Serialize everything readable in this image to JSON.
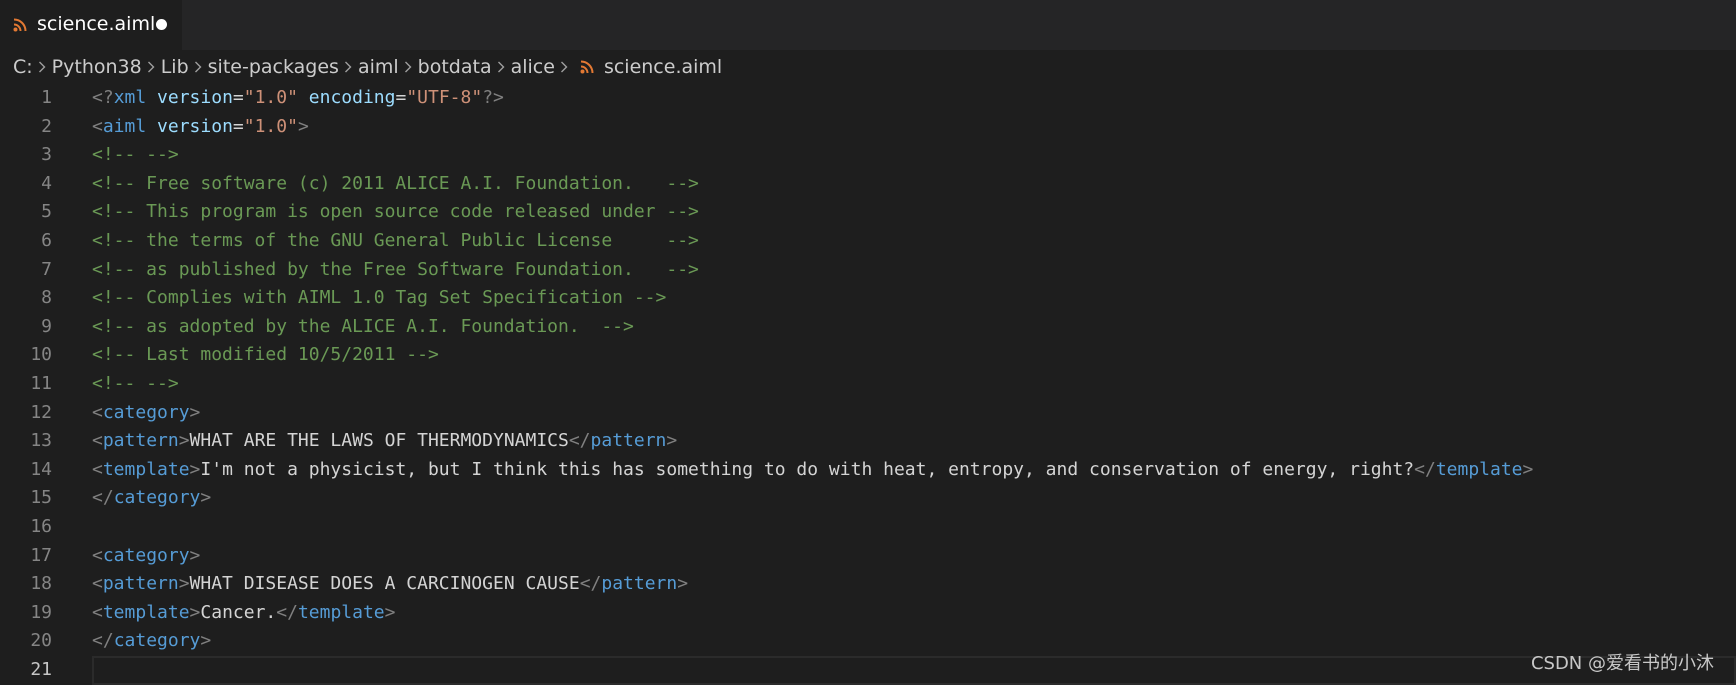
{
  "tab": {
    "label": "science.aiml",
    "icon": "rss-file-icon",
    "dirty": true
  },
  "breadcrumb": [
    "C:",
    "Python38",
    "Lib",
    "site-packages",
    "aiml",
    "botdata",
    "alice",
    "science.aiml"
  ],
  "colors": {
    "tag": "#808080",
    "name": "#569cd6",
    "attr": "#9cdcfe",
    "string": "#ce9178",
    "comment": "#6a9955",
    "text": "#d4d4d4",
    "file_icon": "#e37933"
  },
  "current_line": 21,
  "lines": [
    {
      "n": "1",
      "tokens": [
        [
          "tag",
          "<?"
        ],
        [
          "name",
          "xml"
        ],
        [
          "text",
          " "
        ],
        [
          "attr",
          "version"
        ],
        [
          "text",
          "="
        ],
        [
          "str",
          "\"1.0\""
        ],
        [
          "text",
          " "
        ],
        [
          "attr",
          "encoding"
        ],
        [
          "text",
          "="
        ],
        [
          "str",
          "\"UTF-8\""
        ],
        [
          "tag",
          "?>"
        ]
      ]
    },
    {
      "n": "2",
      "tokens": [
        [
          "tag",
          "<"
        ],
        [
          "name",
          "aiml"
        ],
        [
          "text",
          " "
        ],
        [
          "attr",
          "version"
        ],
        [
          "text",
          "="
        ],
        [
          "str",
          "\"1.0\""
        ],
        [
          "tag",
          ">"
        ]
      ]
    },
    {
      "n": "3",
      "tokens": [
        [
          "comment",
          "<!-- -->"
        ]
      ]
    },
    {
      "n": "4",
      "tokens": [
        [
          "comment",
          "<!-- Free software (c) 2011 ALICE A.I. Foundation.   -->"
        ]
      ]
    },
    {
      "n": "5",
      "tokens": [
        [
          "comment",
          "<!-- This program is open source code released under -->"
        ]
      ]
    },
    {
      "n": "6",
      "tokens": [
        [
          "comment",
          "<!-- the terms of the GNU General Public License     -->"
        ]
      ]
    },
    {
      "n": "7",
      "tokens": [
        [
          "comment",
          "<!-- as published by the Free Software Foundation.   -->"
        ]
      ]
    },
    {
      "n": "8",
      "tokens": [
        [
          "comment",
          "<!-- Complies with AIML 1.0 Tag Set Specification -->"
        ]
      ]
    },
    {
      "n": "9",
      "tokens": [
        [
          "comment",
          "<!-- as adopted by the ALICE A.I. Foundation.  -->"
        ]
      ]
    },
    {
      "n": "10",
      "tokens": [
        [
          "comment",
          "<!-- Last modified 10/5/2011 -->"
        ]
      ]
    },
    {
      "n": "11",
      "tokens": [
        [
          "comment",
          "<!-- -->"
        ]
      ]
    },
    {
      "n": "12",
      "tokens": [
        [
          "tag",
          "<"
        ],
        [
          "name",
          "category"
        ],
        [
          "tag",
          ">"
        ]
      ]
    },
    {
      "n": "13",
      "tokens": [
        [
          "tag",
          "<"
        ],
        [
          "name",
          "pattern"
        ],
        [
          "tag",
          ">"
        ],
        [
          "text",
          "WHAT ARE THE LAWS OF THERMODYNAMICS"
        ],
        [
          "tag",
          "</"
        ],
        [
          "name",
          "pattern"
        ],
        [
          "tag",
          ">"
        ]
      ]
    },
    {
      "n": "14",
      "tokens": [
        [
          "tag",
          "<"
        ],
        [
          "name",
          "template"
        ],
        [
          "tag",
          ">"
        ],
        [
          "text",
          "I'm not a physicist, but I think this has something to do with heat, entropy, and conservation of energy, right?"
        ],
        [
          "tag",
          "</"
        ],
        [
          "name",
          "template"
        ],
        [
          "tag",
          ">"
        ]
      ]
    },
    {
      "n": "15",
      "tokens": [
        [
          "tag",
          "</"
        ],
        [
          "name",
          "category"
        ],
        [
          "tag",
          ">"
        ]
      ]
    },
    {
      "n": "16",
      "tokens": []
    },
    {
      "n": "17",
      "tokens": [
        [
          "tag",
          "<"
        ],
        [
          "name",
          "category"
        ],
        [
          "tag",
          ">"
        ]
      ]
    },
    {
      "n": "18",
      "tokens": [
        [
          "tag",
          "<"
        ],
        [
          "name",
          "pattern"
        ],
        [
          "tag",
          ">"
        ],
        [
          "text",
          "WHAT DISEASE DOES A CARCINOGEN CAUSE"
        ],
        [
          "tag",
          "</"
        ],
        [
          "name",
          "pattern"
        ],
        [
          "tag",
          ">"
        ]
      ]
    },
    {
      "n": "19",
      "tokens": [
        [
          "tag",
          "<"
        ],
        [
          "name",
          "template"
        ],
        [
          "tag",
          ">"
        ],
        [
          "text",
          "Cancer."
        ],
        [
          "tag",
          "</"
        ],
        [
          "name",
          "template"
        ],
        [
          "tag",
          ">"
        ]
      ]
    },
    {
      "n": "20",
      "tokens": [
        [
          "tag",
          "</"
        ],
        [
          "name",
          "category"
        ],
        [
          "tag",
          ">"
        ]
      ]
    },
    {
      "n": "21",
      "tokens": []
    }
  ],
  "watermark": "CSDN @爱看书的小沐"
}
